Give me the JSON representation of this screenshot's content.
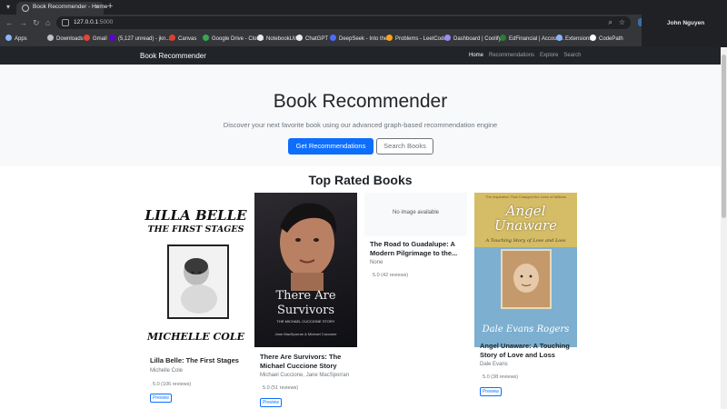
{
  "browser": {
    "tab_title": "Book Recommender - Home",
    "url_host": "127.0.0.1",
    "url_port": ":5000",
    "profile_name": "John Nguyen",
    "bookmarks": [
      {
        "label": "Apps",
        "color": "#8ab4f8"
      },
      {
        "label": "Downloads",
        "color": "#bdc1c6"
      },
      {
        "label": "Gmail",
        "color": "#ea4335"
      },
      {
        "label": "(5,127 unread) - jkn...",
        "color": "#6001d2"
      },
      {
        "label": "Canvas",
        "color": "#e03e2d"
      },
      {
        "label": "Google Drive - Clou...",
        "color": "#34a853"
      },
      {
        "label": "NotebookLM",
        "color": "#e8eaed"
      },
      {
        "label": "ChatGPT",
        "color": "#e8eaed"
      },
      {
        "label": "DeepSeek - Into the...",
        "color": "#4d6bfe"
      },
      {
        "label": "Problems - LeetCode",
        "color": "#ffa116"
      },
      {
        "label": "Dashboard | Coolify",
        "color": "#9b8afb"
      },
      {
        "label": "EdFinancial | Accoun...",
        "color": "#2e7d32"
      },
      {
        "label": "Extensions",
        "color": "#8ab4f8"
      },
      {
        "label": "CodePath",
        "color": "#ffffff"
      }
    ]
  },
  "navbar": {
    "brand": "Book Recommender",
    "links": [
      "Home",
      "Recommendations",
      "Explore",
      "Search"
    ]
  },
  "hero": {
    "title": "Book Recommender",
    "subtitle": "Discover your next favorite book using our advanced graph-based recommendation engine",
    "primary_button": "Get Recommendations",
    "secondary_button": "Search Books"
  },
  "section_title": "Top Rated Books",
  "books": [
    {
      "title": "Lilla Belle: The First Stages",
      "author": "Michelle Cole",
      "rating": "5.0 (106 reviews)",
      "preview": "Preview",
      "cover": {
        "line1": "LILLA BELLE",
        "line2": "THE FIRST STAGES",
        "line3": "MICHELLE COLE"
      }
    },
    {
      "title": "There Are Survivors: The Michael Cuccione Story",
      "author": "Michael Cuccione, Jane MacSporran",
      "rating": "5.0 (51 reviews)",
      "preview": "Preview",
      "cover": {
        "line1": "There Are Survivors",
        "line2": "THE MICHAEL CUCCIONE STORY",
        "line3": "Jane MacSporran & Michael Cuccione"
      }
    },
    {
      "title": "The Road to Guadalupe: A Modern Pilgrimage to the...",
      "author": "None",
      "rating": "5.0 (42 reviews)",
      "cover": {
        "placeholder": "No image available"
      }
    },
    {
      "title": "Angel Unaware: A Touching Story of Love and Loss",
      "author": "Dale Evans",
      "rating": "5.0 (38 reviews)",
      "preview": "Preview",
      "cover": {
        "line0": "The Inspiration That Changed the Lives of Millions",
        "line1": "Angel Unaware",
        "line2": "A Touching Story of Love and Loss",
        "line3": "Dale Evans Rogers"
      }
    }
  ]
}
